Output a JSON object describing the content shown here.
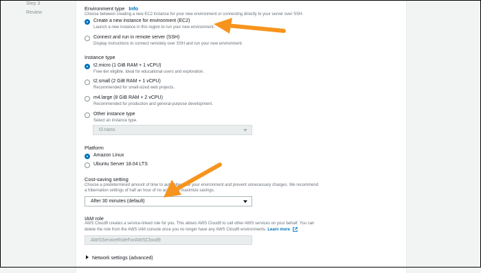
{
  "sidebar": {
    "steps": [
      "Step 3",
      "Review"
    ]
  },
  "environment_type": {
    "heading": "Environment type",
    "info": "Info",
    "description": "Choose between creating a new EC2 instance for your new environment or connecting directly to your server over SSH.",
    "options": [
      {
        "label": "Create a new instance for environment (EC2)",
        "desc": "Launch a new instance in this region to run your new environment.",
        "selected": true
      },
      {
        "label": "Connect and run in remote server (SSH)",
        "desc": "Display instructions to connect remotely over SSH and run your new environment.",
        "selected": false
      }
    ]
  },
  "instance_type": {
    "heading": "Instance type",
    "options": [
      {
        "label": "t2.micro (1 GiB RAM + 1 vCPU)",
        "desc": "Free-tier eligible. Ideal for educational users and exploration.",
        "selected": true
      },
      {
        "label": "t2.small (2 GiB RAM + 1 vCPU)",
        "desc": "Recommended for small-sized web projects.",
        "selected": false
      },
      {
        "label": "m4.large (8 GiB RAM + 2 vCPU)",
        "desc": "Recommended for production and general-purpose development.",
        "selected": false
      },
      {
        "label": "Other instance type",
        "desc": "Select an instance type.",
        "selected": false
      }
    ],
    "other_select_value": "t3.nano"
  },
  "platform": {
    "heading": "Platform",
    "options": [
      {
        "label": "Amazon Linux",
        "selected": true
      },
      {
        "label": "Ubuntu Server 18.04 LTS",
        "selected": false
      }
    ]
  },
  "cost_saving": {
    "heading": "Cost-saving setting",
    "desc_line1": "Choose a predetermined amount of time to auto-hibernate your environment and prevent unnecessary charges. We recommend",
    "desc_line2": "a hibernation settings of half an hour of no activity to maximize savings.",
    "value": "After 30 minutes (default)"
  },
  "iam_role": {
    "heading": "IAM role",
    "desc_line1": "AWS Cloud9 creates a service-linked role for you. This allows AWS Cloud9 to call other AWS services on your behalf. You can",
    "desc_line2": "delete the role from the AWS IAM console once you no longer have any AWS Cloud9 environments.",
    "learn_more": "Learn more",
    "value": "AWSServiceRoleForAWSCloud9"
  },
  "network": {
    "label": "Network settings (advanced)"
  },
  "colors": {
    "accent": "#0073bb",
    "arrow": "#f7941d"
  }
}
